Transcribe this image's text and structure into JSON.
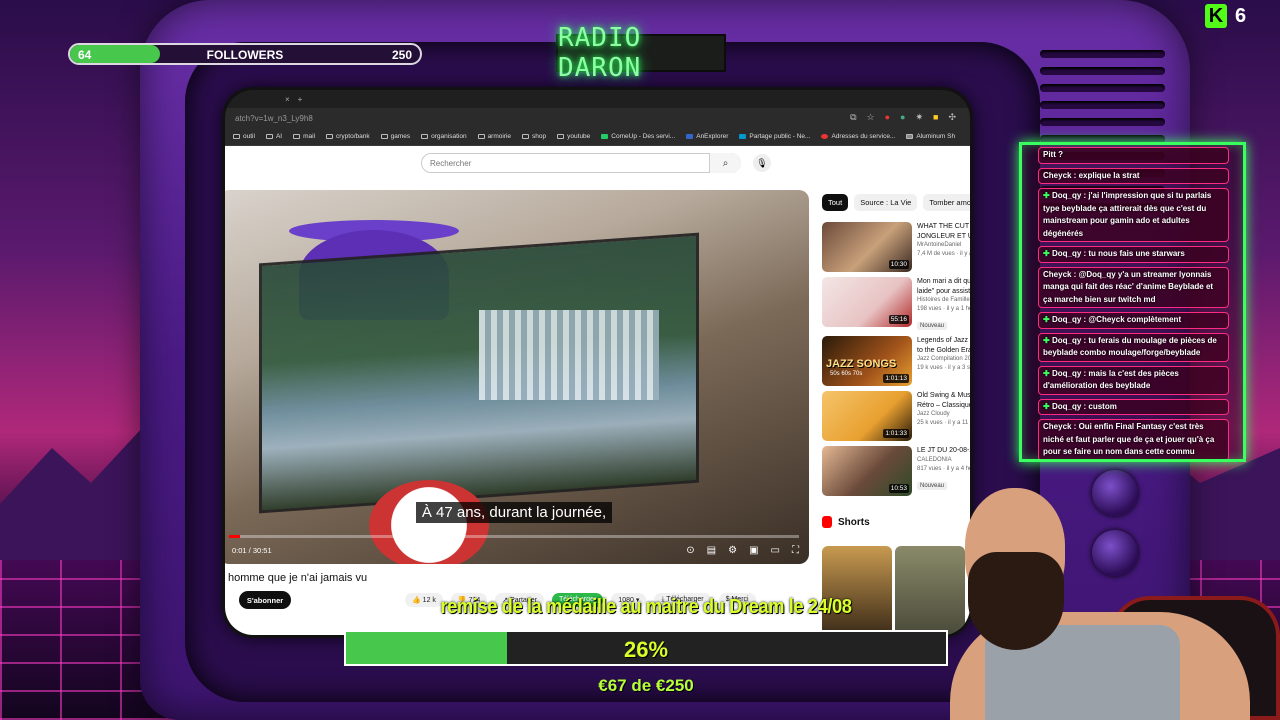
{
  "followers_goal": {
    "current": "64",
    "label": "FOLLOWERS",
    "target": "250",
    "progress": 0.256
  },
  "radio_title": "RADIO DARON",
  "kick": {
    "count": "6"
  },
  "browser": {
    "tab_close": "×",
    "tab_new": "+",
    "url": "atch?v=1w_n3_Ly9h8",
    "bookmarks": [
      "outil",
      "AI",
      "mail",
      "crypto/bank",
      "games",
      "organisation",
      "armoirie",
      "shop",
      "youtube",
      "ComeUp - Des servi...",
      "AnExplorer",
      "Partage public - Ne...",
      "Adresses du service...",
      "Aluminum Sh"
    ]
  },
  "youtube": {
    "search_placeholder": "Rechercher",
    "subtitle": "À 47 ans, durant la journée,",
    "time": "0:01 / 30:51",
    "video_title": "homme que je n'ai jamais vu",
    "subscribe": "S'abonner",
    "actions": {
      "likes": "12 k",
      "dislikes": "714",
      "share": "Partager",
      "download_green": "Télécharger",
      "quality": "1080",
      "download": "Télécharger",
      "thanks": "Merci"
    },
    "chips": [
      "Tout",
      "Source : La Vie",
      "Tomber amou"
    ],
    "recommendations": [
      {
        "title1": "WHAT THE CUT #",
        "title2": "JONGLEUR ET UN",
        "channel": "MrAntoineDaniel",
        "meta": "7,4 M de vues · il y a",
        "duration": "10:30",
        "badge": ""
      },
      {
        "title1": "Mon mari a dit qu",
        "title2": "laide\" pour assist",
        "channel": "Histoires de Famille F",
        "meta": "198 vues · il y a 1 heu",
        "duration": "55:16",
        "badge": "Nouveau"
      },
      {
        "title1": "Legends of Jazz &",
        "title2": "to the Golden Era",
        "channel": "Jazz Compilation 202",
        "meta": "19 k vues · il y a 3 se",
        "duration": "1:01:13",
        "badge": ""
      },
      {
        "title1": "Old Swing & Music",
        "title2": "Rétro – Classiques",
        "channel": "Jazz Cloudy",
        "meta": "25 k vues · il y a 11 j",
        "duration": "1:01:33",
        "badge": ""
      },
      {
        "title1": "LE JT DU 20-08-2",
        "title2": "CALEDONIA",
        "channel": "",
        "meta": "817 vues · il y a 4 heu",
        "duration": "10:53",
        "badge": "Nouveau"
      }
    ],
    "thumb_texts": {
      "jazz": "JAZZ SONGS",
      "jazz_sub": "50s 60s 70s"
    },
    "shorts": "Shorts"
  },
  "chat": {
    "messages": [
      {
        "text": "Pitt ?",
        "plus": false
      },
      {
        "text": "Cheyck : explique la strat",
        "plus": false
      },
      {
        "text": "Doq_qy : j'ai l'impression que si tu parlais type beyblade ça attirerait dès que c'est du mainstream pour gamin ado et adultes dégénérés",
        "plus": true
      },
      {
        "text": "Doq_qy : tu nous fais une starwars",
        "plus": true
      },
      {
        "text": "Cheyck : @Doq_qy y'a un streamer lyonnais manga qui fait des réac' d'anime Beyblade et ça marche bien sur twitch md",
        "plus": false
      },
      {
        "text": "Doq_qy : @Cheyck complètement",
        "plus": true
      },
      {
        "text": "Doq_qy : tu ferais du moulage de pièces de beyblade combo moulage/forge/beyblade",
        "plus": true
      },
      {
        "text": "Doq_qy : mais la c'est des pièces d'amélioration des beyblade",
        "plus": true
      },
      {
        "text": "Doq_qy : custom",
        "plus": true
      },
      {
        "text": "Cheyck : Oui enfin Final Fantasy c'est très niché et faut parler que de ça et jouer qu'à ça pour se faire un nom dans cette commu",
        "plus": false
      }
    ]
  },
  "donation_goal": {
    "label": "remise de la médaille au maitre du Dream le 24/08",
    "percent": "26%",
    "progress": 0.268,
    "amount": "€67 de €250"
  },
  "colors": {
    "neon_green": "#39ff5f",
    "progress_green": "#47c84c",
    "goal_text": "#d8ff2a",
    "chat_border": "#ff2a82",
    "tv_purple": "#5b2396"
  }
}
